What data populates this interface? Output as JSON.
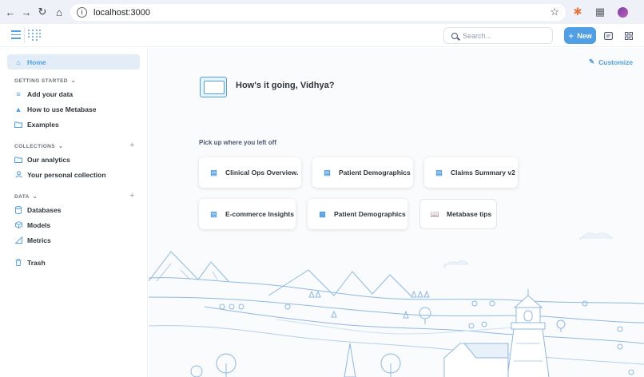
{
  "browser": {
    "url": "localhost:3000"
  },
  "header": {
    "search_placeholder": "Search...",
    "new_label": "New"
  },
  "sidebar": {
    "home": "Home",
    "getting_started": {
      "heading": "GETTING STARTED",
      "items": [
        "Add your data",
        "How to use Metabase",
        "Examples"
      ]
    },
    "collections": {
      "heading": "COLLECTIONS",
      "items": [
        "Our analytics",
        "Your personal collection"
      ]
    },
    "data": {
      "heading": "DATA",
      "items": [
        "Databases",
        "Models",
        "Metrics"
      ]
    },
    "trash": "Trash"
  },
  "main": {
    "customize": "Customize",
    "greeting": "How's it going, Vidhya?",
    "pickup_heading": "Pick up where you left off",
    "cards": [
      "Clinical Ops Overview.",
      "Patient Demographics",
      "Claims Summary v2",
      "E-commerce Insights",
      "Patient Demographics",
      "Metabase tips"
    ]
  },
  "colors": {
    "brand": "#509ee3",
    "text": "#2e353b",
    "sidebar_active": "#e3edf8"
  }
}
